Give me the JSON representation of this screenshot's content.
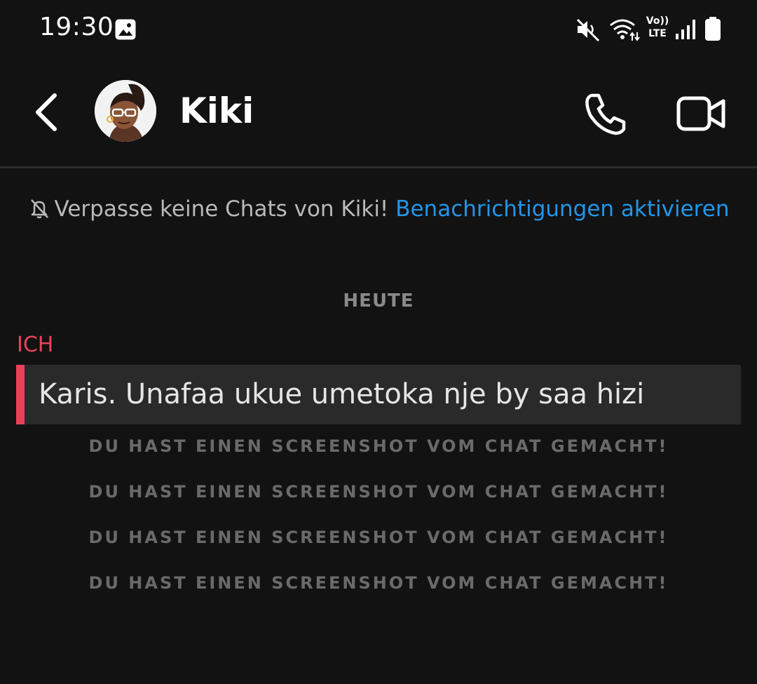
{
  "status_bar": {
    "time": "19:30",
    "icons": [
      "gallery-icon",
      "mute-icon",
      "wifi-icon",
      "volte-icon",
      "signal-icon",
      "battery-icon"
    ],
    "volte_top": "Vo))",
    "volte_bottom": "LTE"
  },
  "header": {
    "contact_name": "Kiki",
    "icons": [
      "back-arrow-icon",
      "avatar",
      "phone-icon",
      "video-camera-icon"
    ]
  },
  "notification_banner": {
    "text": "Verpasse keine Chats von Kiki!",
    "link": "Benachrichtigungen aktivieren",
    "icon": "bell-off-icon"
  },
  "chat": {
    "date_label": "HEUTE",
    "sender": "ICH",
    "message": "Karis. Unafaa ukue umetoka nje by saa hizi",
    "notices": [
      "DU HAST EINEN SCREENSHOT VOM CHAT GEMACHT!",
      "DU HAST EINEN SCREENSHOT VOM CHAT GEMACHT!",
      "DU HAST EINEN SCREENSHOT VOM CHAT GEMACHT!",
      "DU HAST EINEN SCREENSHOT VOM CHAT GEMACHT!"
    ]
  },
  "colors": {
    "background": "#121212",
    "accent_red": "#e8425a",
    "link_blue": "#2196e8",
    "message_bg": "#2a2a2a"
  }
}
